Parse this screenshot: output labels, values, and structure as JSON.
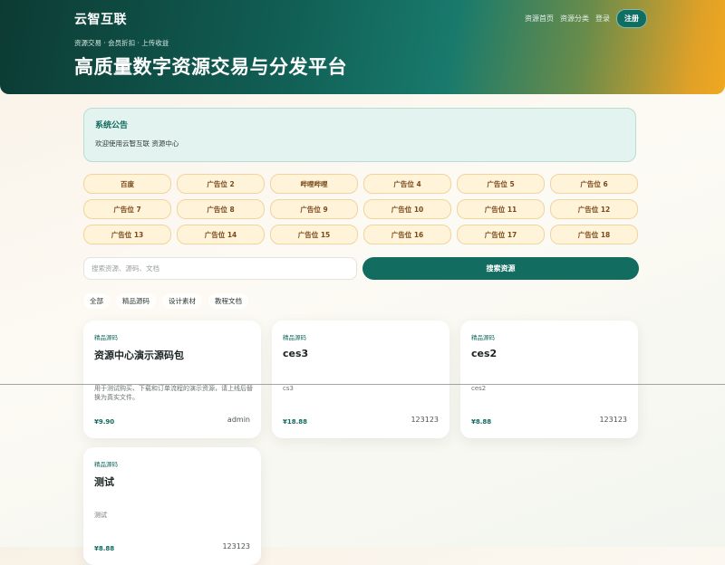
{
  "header": {
    "brand": "云智互联",
    "nav": [
      "资源首页",
      "资源分类",
      "登录"
    ],
    "register": "注册",
    "tagline": "资源交易 · 会员折扣 · 上传收益",
    "title": "高质量数字资源交易与分发平台"
  },
  "notice": {
    "title": "系统公告",
    "text": "欢迎使用云智互联 资源中心"
  },
  "ads": [
    "百度",
    "广告位 2",
    "哔哩哔哩",
    "广告位 4",
    "广告位 5",
    "广告位 6",
    "广告位 7",
    "广告位 8",
    "广告位 9",
    "广告位 10",
    "广告位 11",
    "广告位 12",
    "广告位 13",
    "广告位 14",
    "广告位 15",
    "广告位 16",
    "广告位 17",
    "广告位 18"
  ],
  "search": {
    "placeholder": "搜索资源、源码、文档",
    "button": "搜索资源"
  },
  "categories": [
    "全部",
    "精品源码",
    "设计素材",
    "教程文档"
  ],
  "cards": [
    {
      "category": "精品源码",
      "title": "资源中心演示源码包",
      "desc": "用于测试购买、下载和订单流程的演示资源，请上线后替换为真实文件。",
      "price": "¥9.90",
      "author": "admin"
    },
    {
      "category": "精品源码",
      "title": "ces3",
      "desc": "cs3",
      "price": "¥18.88",
      "author": "123123"
    },
    {
      "category": "精品源码",
      "title": "ces2",
      "desc": "ces2",
      "price": "¥8.88",
      "author": "123123"
    },
    {
      "category": "精品源码",
      "title": "测试",
      "desc": "测试",
      "price": "¥8.88",
      "author": "123123"
    }
  ]
}
